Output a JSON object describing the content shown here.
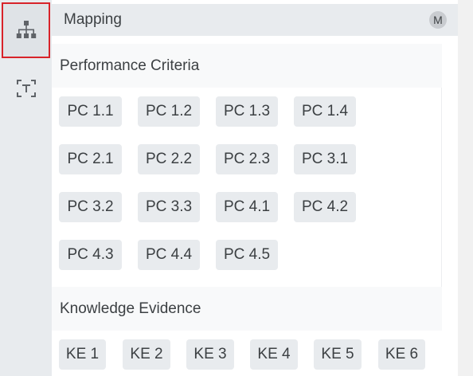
{
  "header": {
    "title": "Mapping",
    "badge": "M"
  },
  "sidebar": {
    "items": [
      {
        "icon": "sitemap-icon",
        "active": true
      },
      {
        "icon": "text-select-icon",
        "active": false
      }
    ]
  },
  "performance_criteria": {
    "title": "Performance Criteria",
    "rows": [
      [
        "PC 1.1",
        "PC 1.2",
        "PC 1.3",
        "PC 1.4"
      ],
      [
        "PC 2.1",
        "PC 2.2",
        "PC 2.3",
        "PC 3.1"
      ],
      [
        "PC 3.2",
        "PC 3.3",
        "PC 4.1",
        "PC 4.2"
      ],
      [
        "PC 4.3",
        "PC 4.4",
        "PC 4.5"
      ]
    ]
  },
  "knowledge_evidence": {
    "title": "Knowledge Evidence",
    "items": [
      "KE 1",
      "KE 2",
      "KE 3",
      "KE 4",
      "KE 5",
      "KE 6"
    ]
  },
  "colors": {
    "active_outline": "#d8232a",
    "rail_bg": "#e8ebee",
    "chip_bg": "#e8ebee"
  }
}
